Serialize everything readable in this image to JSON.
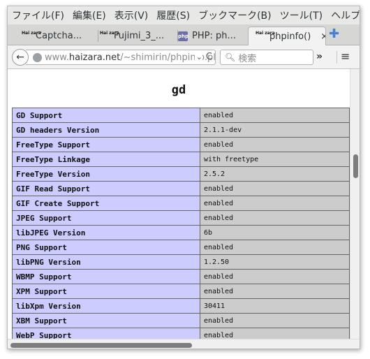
{
  "menubar": {
    "items": [
      "ファイル(F)",
      "編集(E)",
      "表示(V)",
      "履歴(S)",
      "ブックマーク(B)",
      "ツール(T)",
      "ヘルプ(H)"
    ]
  },
  "tabs": [
    {
      "favicon": "Hai zara",
      "title": "Captcha..."
    },
    {
      "favicon": "Hai zara",
      "title": "Fujimi_3_..."
    },
    {
      "favicon": "php",
      "title": "PHP: ph..."
    },
    {
      "favicon": "Hai zara",
      "title": "phpinfo()",
      "active": true,
      "close": "×"
    }
  ],
  "newtab_icon": "plus-icon",
  "navbar": {
    "back_glyph": "←",
    "url_prefix": "www.",
    "url_host": "haizara.net",
    "url_path": "/~shimirin/phpinfo.pl",
    "url_dropdown": "⌄",
    "reload_glyph": "C",
    "search_placeholder": "検索",
    "overflow_glyph": "»",
    "menu_glyph": "≡"
  },
  "page": {
    "section_title": "gd",
    "rows": [
      {
        "directive": "GD Support",
        "value": "enabled"
      },
      {
        "directive": "GD headers Version",
        "value": "2.1.1-dev"
      },
      {
        "directive": "FreeType Support",
        "value": "enabled"
      },
      {
        "directive": "FreeType Linkage",
        "value": "with freetype"
      },
      {
        "directive": "FreeType Version",
        "value": "2.5.2"
      },
      {
        "directive": "GIF Read Support",
        "value": "enabled"
      },
      {
        "directive": "GIF Create Support",
        "value": "enabled"
      },
      {
        "directive": "JPEG Support",
        "value": "enabled"
      },
      {
        "directive": "libJPEG Version",
        "value": "6b"
      },
      {
        "directive": "PNG Support",
        "value": "enabled"
      },
      {
        "directive": "libPNG Version",
        "value": "1.2.50"
      },
      {
        "directive": "WBMP Support",
        "value": "enabled"
      },
      {
        "directive": "XPM Support",
        "value": "enabled"
      },
      {
        "directive": "libXpm Version",
        "value": "30411"
      },
      {
        "directive": "XBM Support",
        "value": "enabled"
      },
      {
        "directive": "WebP Support",
        "value": "enabled"
      }
    ]
  },
  "colors": {
    "directive_cell": "#ccccff",
    "value_cell": "#cccccc",
    "tab_strip": "#d6d6d5",
    "new_tab": "#4a7fd1"
  }
}
